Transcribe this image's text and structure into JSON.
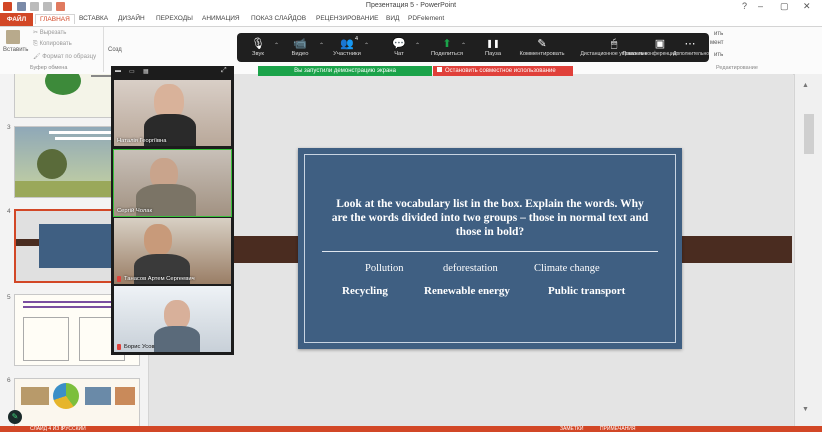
{
  "window": {
    "title": "Презентация 5 - PowerPoint"
  },
  "ribbon": {
    "tabs": [
      "ФАЙЛ",
      "ГЛАВНАЯ",
      "ВСТАВКА",
      "ДИЗАЙН",
      "ПЕРЕХОДЫ",
      "АНИМАЦИЯ",
      "ПОКАЗ СЛАЙДОВ",
      "РЕЦЕНЗИРОВАНИЕ",
      "ВИД",
      "PDFelement"
    ],
    "clipboard": {
      "paste": "Вставить",
      "cut": "Вырезать",
      "copy": "Копировать",
      "format": "Формат по образцу",
      "group": "Буфер обмена"
    },
    "create": "Созд",
    "right_items": [
      "мент",
      "ить",
      "ить"
    ],
    "edit_group": "Редактирование"
  },
  "zoom_toolbar": {
    "items": [
      {
        "label": "Звук",
        "icon": "microphone-icon",
        "glyph": "🎙"
      },
      {
        "label": "Видео",
        "icon": "video-camera-icon",
        "glyph": "📹"
      },
      {
        "label": "Участники",
        "icon": "participants-icon",
        "glyph": "👥",
        "count": "4"
      },
      {
        "label": "Чат",
        "icon": "chat-icon",
        "glyph": "💬"
      },
      {
        "label": "Поделиться",
        "icon": "share-screen-icon",
        "glyph": "⬆"
      },
      {
        "label": "Пауза",
        "icon": "pause-icon",
        "glyph": "❚❚"
      },
      {
        "label": "Комментировать",
        "icon": "annotate-pen-icon",
        "glyph": "✎"
      },
      {
        "label": "Дистанционное управление",
        "icon": "mouse-icon",
        "glyph": "🖱"
      },
      {
        "label": "Показать конференцию",
        "icon": "show-meeting-icon",
        "glyph": "▣"
      },
      {
        "label": "Дополнительно",
        "icon": "more-icon",
        "glyph": "⋯"
      }
    ]
  },
  "share_status": {
    "sharing": "Вы запустили демонстрацию экрана",
    "stop": "Остановить совместное использование"
  },
  "slides_pane": {
    "numbers": [
      "3",
      "4",
      "5",
      "6"
    ]
  },
  "slide": {
    "question": "Look at the vocabulary list in the box. Explain the words. Why are the words divided into two groups – those in normal text and those in bold?",
    "normal_words": [
      "Pollution",
      "deforestation",
      "Climate change"
    ],
    "bold_words": [
      "Recycling",
      "Renewable energy",
      "Public transport"
    ]
  },
  "participants": [
    {
      "name": "Наталія Георгіївна"
    },
    {
      "name": "Сергій Чолак"
    },
    {
      "name": "Танасов Артем Сергеевич"
    },
    {
      "name": "Борис Усов"
    }
  ],
  "statusbar": {
    "left": "СЛАЙД 4 ИЗ 8",
    "lang": "РУССКИЙ",
    "notes": "ЗАМЕТКИ",
    "comments": "ПРИМЕЧАНИЯ"
  },
  "colors": {
    "accent": "#d24726",
    "slide_bg": "#3f5f82",
    "zoom_bar": "#1f1f1f",
    "share_green": "#1ba34a",
    "share_red": "#e0403a"
  }
}
